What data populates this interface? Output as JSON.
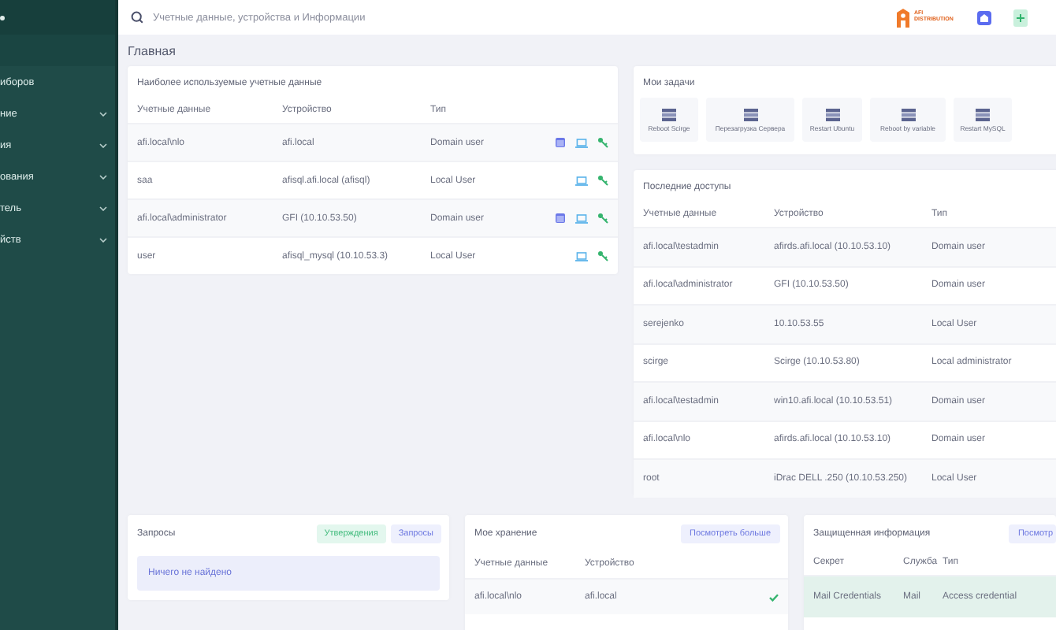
{
  "sidebar": {
    "items": [
      {
        "label": "иборов",
        "expandable": false
      },
      {
        "label": "ние",
        "expandable": true
      },
      {
        "label": "ия",
        "expandable": true
      },
      {
        "label": "ования",
        "expandable": true
      },
      {
        "label": "тель",
        "expandable": true
      },
      {
        "label": "йств",
        "expandable": true
      }
    ]
  },
  "search": {
    "placeholder": "Учетные данные, устройства и Информации"
  },
  "logo": {
    "text": "AFI DISTRIBUTION"
  },
  "page_title": "Главная",
  "most_used": {
    "title": "Наиболее используемые учетные данные",
    "columns": [
      "Учетные данные",
      "Устройство",
      "Тип"
    ],
    "rows": [
      {
        "cells": [
          "afi.local\\nlo",
          "afi.local",
          "Domain user"
        ],
        "web": true
      },
      {
        "cells": [
          "saa",
          "afisql.afi.local (afisql)",
          "Local User"
        ],
        "web": false
      },
      {
        "cells": [
          "afi.local\\administrator",
          "GFI (10.10.53.50)",
          "Domain user"
        ],
        "web": true
      },
      {
        "cells": [
          "user",
          "afisql_mysql (10.10.53.3)",
          "Local User"
        ],
        "web": false
      }
    ]
  },
  "tasks": {
    "title": "Мои задачи",
    "items": [
      "Reboot Scirge",
      "Перезагрузка Сервера",
      "Restart Ubuntu",
      "Reboot by variable",
      "Restart MySQL"
    ]
  },
  "recent": {
    "title": "Последние доступы",
    "columns": [
      "Учетные данные",
      "Устройство",
      "Тип"
    ],
    "rows": [
      [
        "afi.local\\testadmin",
        "afirds.afi.local (10.10.53.10)",
        "Domain user"
      ],
      [
        "afi.local\\administrator",
        "GFI (10.10.53.50)",
        "Domain user"
      ],
      [
        "serejenko",
        "10.10.53.55",
        "Local User"
      ],
      [
        "scirge",
        "Scirge (10.10.53.80)",
        "Local administrator"
      ],
      [
        "afi.local\\testadmin",
        "win10.afi.local (10.10.53.51)",
        "Domain user"
      ],
      [
        "afi.local\\nlo",
        "afirds.afi.local (10.10.53.10)",
        "Domain user"
      ],
      [
        "root",
        "iDrac DELL .250 (10.10.53.250)",
        "Local User"
      ]
    ]
  },
  "requests": {
    "title": "Запросы",
    "tabs": [
      {
        "label": "Утверждения",
        "selected": true
      },
      {
        "label": "Запросы",
        "selected": false
      }
    ],
    "empty": "Ничего не найдено"
  },
  "storage": {
    "title": "Мое хранение",
    "button": "Посмотреть больше",
    "columns": [
      "Учетные данные",
      "Устройство"
    ],
    "rows": [
      {
        "cells": [
          "afi.local\\nlo",
          "afi.local"
        ],
        "checked": true
      }
    ]
  },
  "protected": {
    "title": "Защищенная информация",
    "button": "Посмотр",
    "columns": [
      "Секрет",
      "Служба",
      "Тип"
    ],
    "rows": [
      [
        "Mail Credentials",
        "Mail",
        "Access credential"
      ]
    ]
  }
}
